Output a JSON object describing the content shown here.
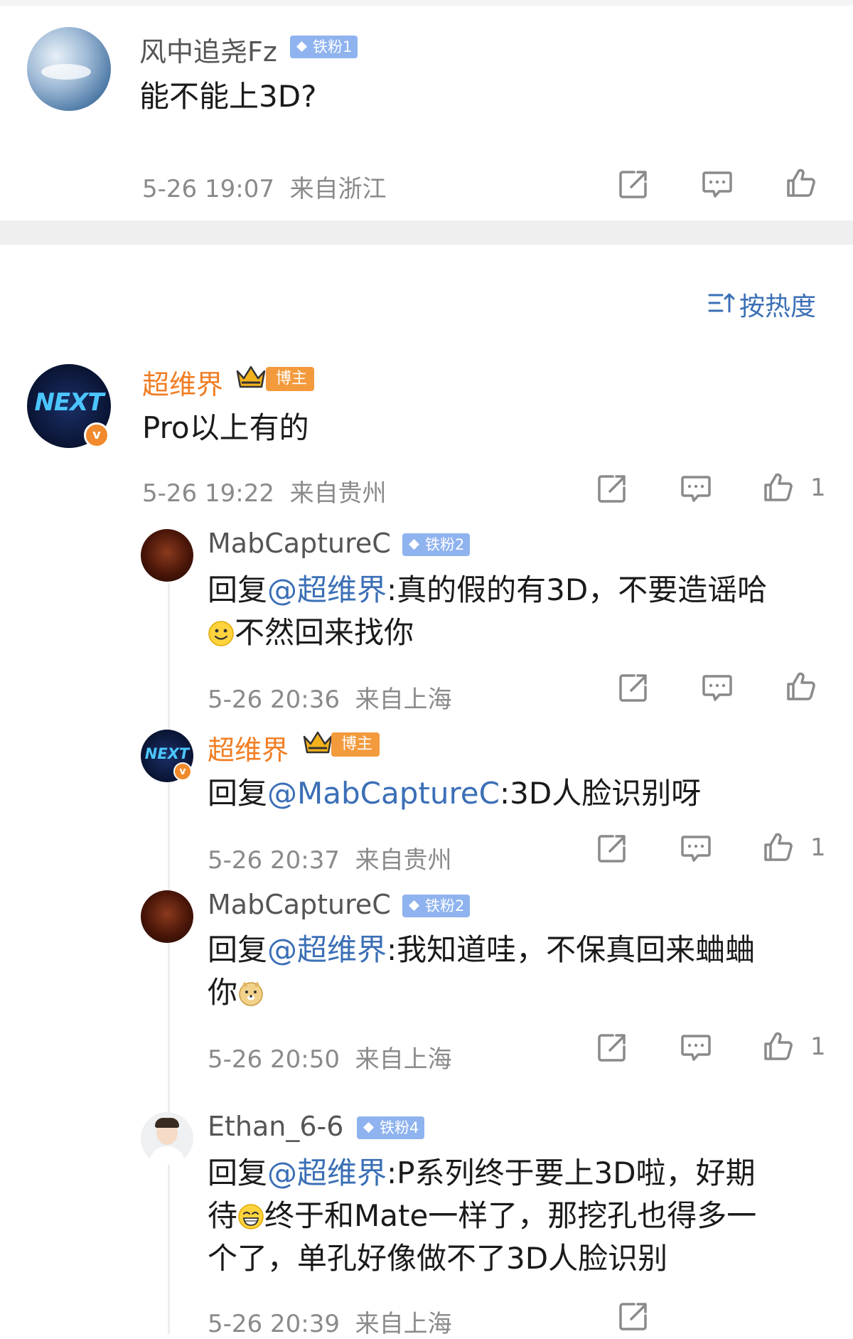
{
  "top_comment": {
    "username": "风中追尧Fz",
    "fan_badge": "铁粉1",
    "text": "能不能上3D?",
    "time": "5-26 19:07",
    "location": "来自浙江"
  },
  "sort_label": "按热度",
  "main_comment": {
    "username": "超维界",
    "badge": "博主",
    "avatar_text": "NEXT",
    "text": "Pro以上有的",
    "time": "5-26 19:22",
    "location": "来自贵州",
    "likes": "1"
  },
  "replies": [
    {
      "username": "MabCaptureC",
      "fan_badge": "铁粉2",
      "reply_prefix": "回复",
      "mention": "@超维界",
      "text_line1": ":真的假的有3D，不要造谣哈",
      "text_line2": "不然回来找你",
      "emoji": "smile-emoji",
      "time": "5-26 20:36",
      "location": "来自上海",
      "likes": ""
    },
    {
      "username": "超维界",
      "badge": "博主",
      "avatar_text": "NEXT",
      "reply_prefix": "回复",
      "mention": "@MabCaptureC",
      "text_line1": ":3D人脸识别呀",
      "time": "5-26 20:37",
      "location": "来自贵州",
      "likes": "1"
    },
    {
      "username": "MabCaptureC",
      "fan_badge": "铁粉2",
      "reply_prefix": "回复",
      "mention": "@超维界",
      "text_line1": ":我知道哇，不保真回来蛐蛐",
      "text_line2": "你",
      "emoji": "doge-emoji",
      "time": "5-26 20:50",
      "location": "来自上海",
      "likes": "1"
    },
    {
      "username": "Ethan_6-6",
      "fan_badge": "铁粉4",
      "reply_prefix": "回复",
      "mention": "@超维界",
      "text_line1": ":P系列终于要上3D啦，好期",
      "text_line2a": "待",
      "text_line2b": "终于和Mate一样了，那挖孔也得多一",
      "text_line3": "个了，单孔好像做不了3D人脸识别",
      "emoji": "grin-emoji",
      "time": "5-26 20:39",
      "location": "来自上海"
    }
  ],
  "icons": {
    "share": "share-icon",
    "comment": "comment-icon",
    "like": "like-icon"
  },
  "colors": {
    "username_orange": "#f27d22",
    "mention_blue": "#3b6fb6",
    "meta_gray": "#8a8a8a",
    "fan_badge": "#8fb3ef",
    "blogger_badge": "#f39a3c"
  }
}
